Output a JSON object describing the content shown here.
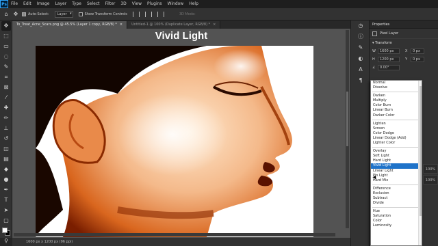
{
  "menubar": {
    "logo": "Ps",
    "items": [
      "File",
      "Edit",
      "Image",
      "Layer",
      "Type",
      "Select",
      "Filter",
      "3D",
      "View",
      "Plugins",
      "Window",
      "Help"
    ]
  },
  "options": {
    "auto_select_label": "Auto-Select:",
    "auto_select_target": "Layer",
    "show_transform_label": "Show Transform Controls",
    "mode_3d_label": "3D Mode:"
  },
  "tabs": [
    {
      "label": "To_Treat_Acne_Scars.png @ 45.5% (Layer 1 copy, RGB/8) *",
      "active": true
    },
    {
      "label": "Untitled-1 @ 100% (Duplicate Layer, RGB/8) *",
      "active": false
    }
  ],
  "canvas": {
    "title": "Vivid Light"
  },
  "status": {
    "text": "1600 px x 1200 px (96 ppi)"
  },
  "panel": {
    "tab_properties": "Properties",
    "layer_label": "Pixel Layer",
    "transform_label": "Transform",
    "w_label": "W",
    "w_value": "1600 px",
    "h_label": "H",
    "h_value": "1200 px",
    "x_label": "X",
    "x_value": "0 px",
    "y_label": "Y",
    "y_value": "0 px",
    "angle_value": "0.00°"
  },
  "blend_modes": {
    "groups": [
      [
        "Normal",
        "Dissolve"
      ],
      [
        "Darken",
        "Multiply",
        "Color Burn",
        "Linear Burn",
        "Darker Color"
      ],
      [
        "Lighten",
        "Screen",
        "Color Dodge",
        "Linear Dodge (Add)",
        "Lighter Color"
      ],
      [
        "Overlay",
        "Soft Light",
        "Hard Light",
        "Vivid Light",
        "Linear Light",
        "Pin Light",
        "Hard Mix"
      ],
      [
        "Difference",
        "Exclusion",
        "Subtract",
        "Divide"
      ],
      [
        "Hue",
        "Saturation",
        "Color",
        "Luminosity"
      ]
    ],
    "selected": "Vivid Light"
  },
  "colors": {
    "accent": "#1f73c9",
    "ps_blue": "#31a8ff",
    "foreground": "#ffffff",
    "background": "#000000"
  },
  "side_values": [
    "100%",
    "100%"
  ]
}
